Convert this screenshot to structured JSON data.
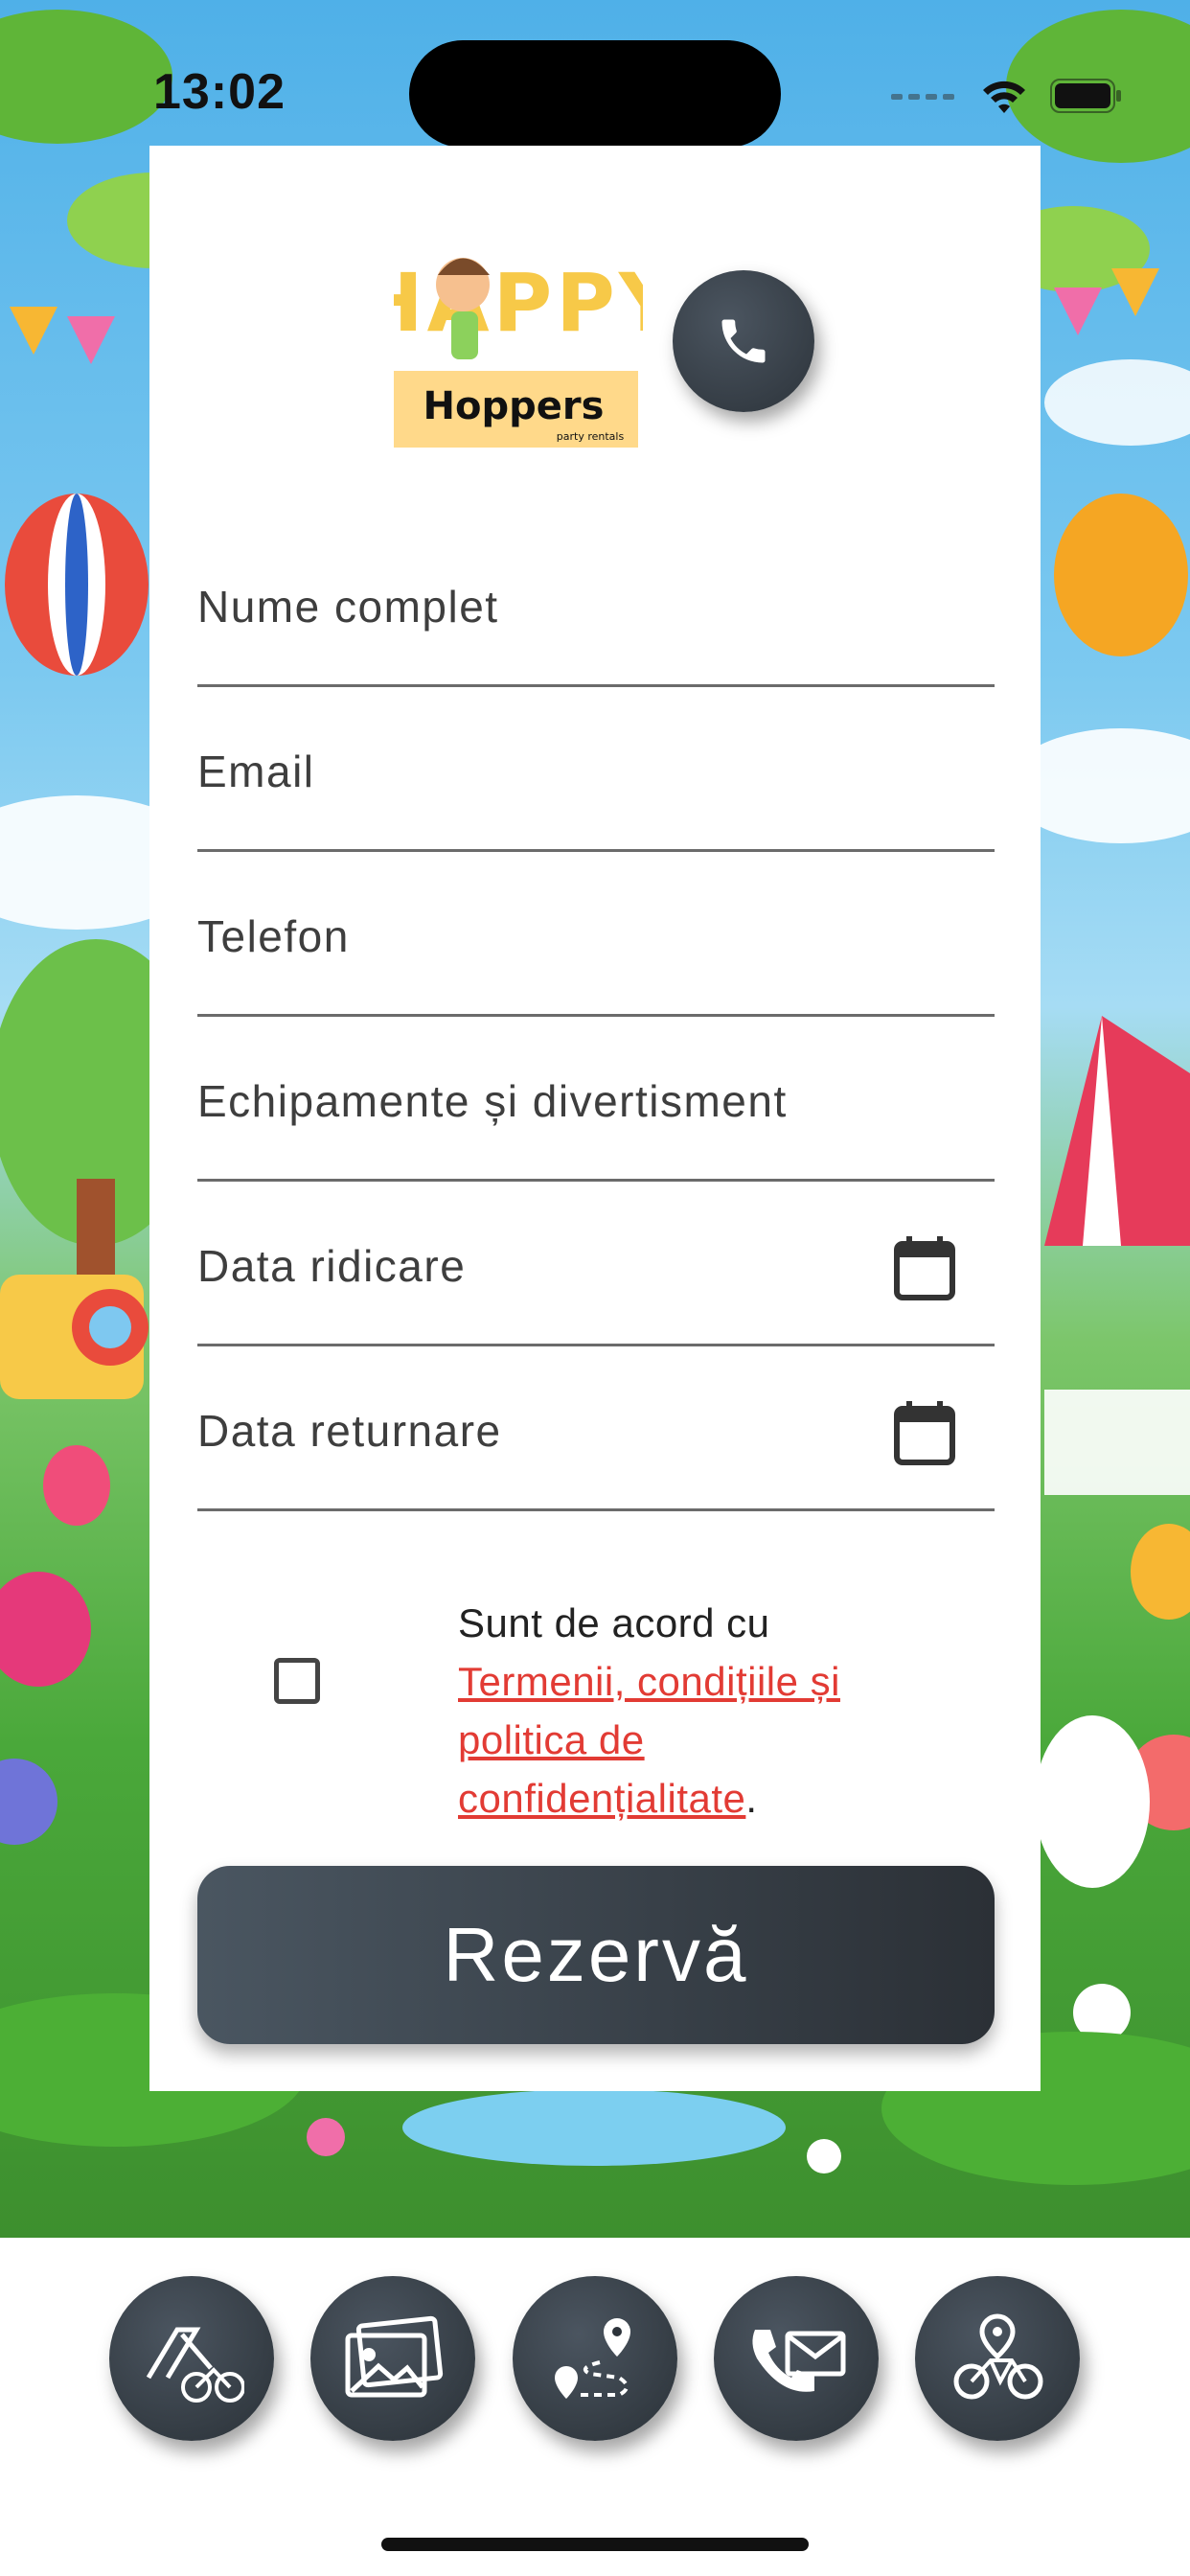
{
  "status_bar": {
    "time": "13:02"
  },
  "header": {
    "logo_text_top": "HAPPY",
    "logo_text_bottom": "Hoppers",
    "logo_subtext": "party rentals"
  },
  "form": {
    "fields": [
      {
        "label": "Nume complet"
      },
      {
        "label": "Email"
      },
      {
        "label": "Telefon"
      },
      {
        "label": "Echipamente și divertisment"
      },
      {
        "label": "Data ridicare"
      },
      {
        "label": "Data returnare"
      }
    ],
    "terms_prefix": "Sunt de acord cu",
    "terms_link": "Termenii, condițiile și politica de confidențialitate",
    "terms_suffix": ".",
    "submit_label": "Rezervă"
  },
  "nav": {
    "items": [
      {
        "icon": "slide-bike-icon"
      },
      {
        "icon": "gallery-icon"
      },
      {
        "icon": "route-icon"
      },
      {
        "icon": "phone-mail-icon"
      },
      {
        "icon": "bike-location-icon"
      }
    ]
  },
  "colors": {
    "accent_dark": "#2f363c",
    "link": "#e23b34"
  }
}
